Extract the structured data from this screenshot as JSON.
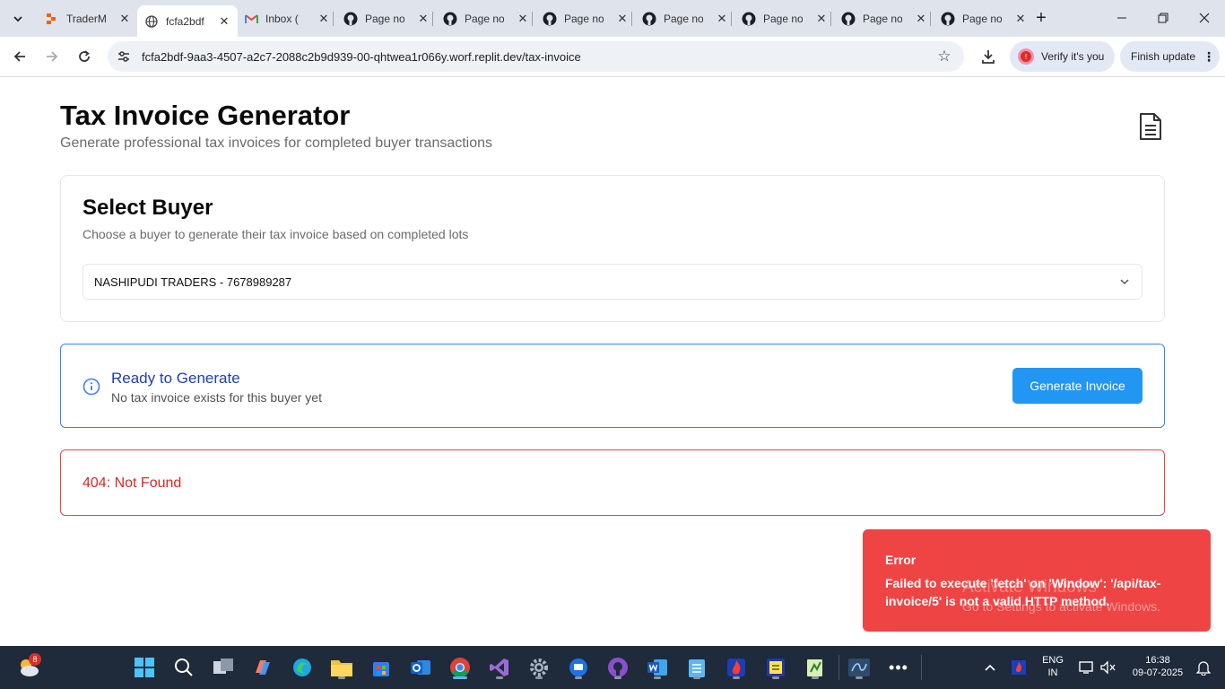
{
  "browser": {
    "tabs": [
      {
        "label": "TraderM",
        "icon": "replit-icon",
        "active": false
      },
      {
        "label": "fcfa2bdf",
        "icon": "globe-icon",
        "active": true
      },
      {
        "label": "Inbox (",
        "icon": "gmail-icon",
        "active": false
      },
      {
        "label": "Page no",
        "icon": "github-icon",
        "active": false
      },
      {
        "label": "Page no",
        "icon": "github-icon",
        "active": false
      },
      {
        "label": "Page no",
        "icon": "github-icon",
        "active": false
      },
      {
        "label": "Page no",
        "icon": "github-icon",
        "active": false
      },
      {
        "label": "Page no",
        "icon": "github-icon",
        "active": false
      },
      {
        "label": "Page no",
        "icon": "github-icon",
        "active": false
      },
      {
        "label": "Page no",
        "icon": "github-icon",
        "active": false
      }
    ],
    "url": "fcfa2bdf-9aa3-4507-a2c7-2088c2b9d939-00-qhtwea1r066y.worf.replit.dev/tax-invoice",
    "verify_label": "Verify it's you",
    "verify_badge": "!",
    "finish_update_label": "Finish update"
  },
  "page": {
    "title": "Tax Invoice Generator",
    "subtitle": "Generate professional tax invoices for completed buyer transactions",
    "buyer_card": {
      "title": "Select Buyer",
      "description": "Choose a buyer to generate their tax invoice based on completed lots",
      "selected_buyer": "NASHIPUDI TRADERS - 7678989287"
    },
    "ready_card": {
      "title": "Ready to Generate",
      "description": "No tax invoice exists for this buyer yet",
      "button_label": "Generate Invoice"
    },
    "error_card": {
      "message": "404: Not Found"
    },
    "toast": {
      "title": "Error",
      "message": "Failed to execute 'fetch' on 'Window': '/api/tax-invoice/5' is not a valid HTTP method."
    },
    "watermark": {
      "line1": "Activate Windows",
      "line2": "Go to Settings to activate Windows."
    }
  },
  "taskbar": {
    "weather_badge": "8",
    "language_line1": "ENG",
    "language_line2": "IN",
    "time": "16:38",
    "date": "09-07-2025"
  },
  "colors": {
    "primary_button": "#2196f3",
    "error": "#ef4444",
    "info_border": "#3b82f6",
    "ready_title": "#1e40af"
  }
}
